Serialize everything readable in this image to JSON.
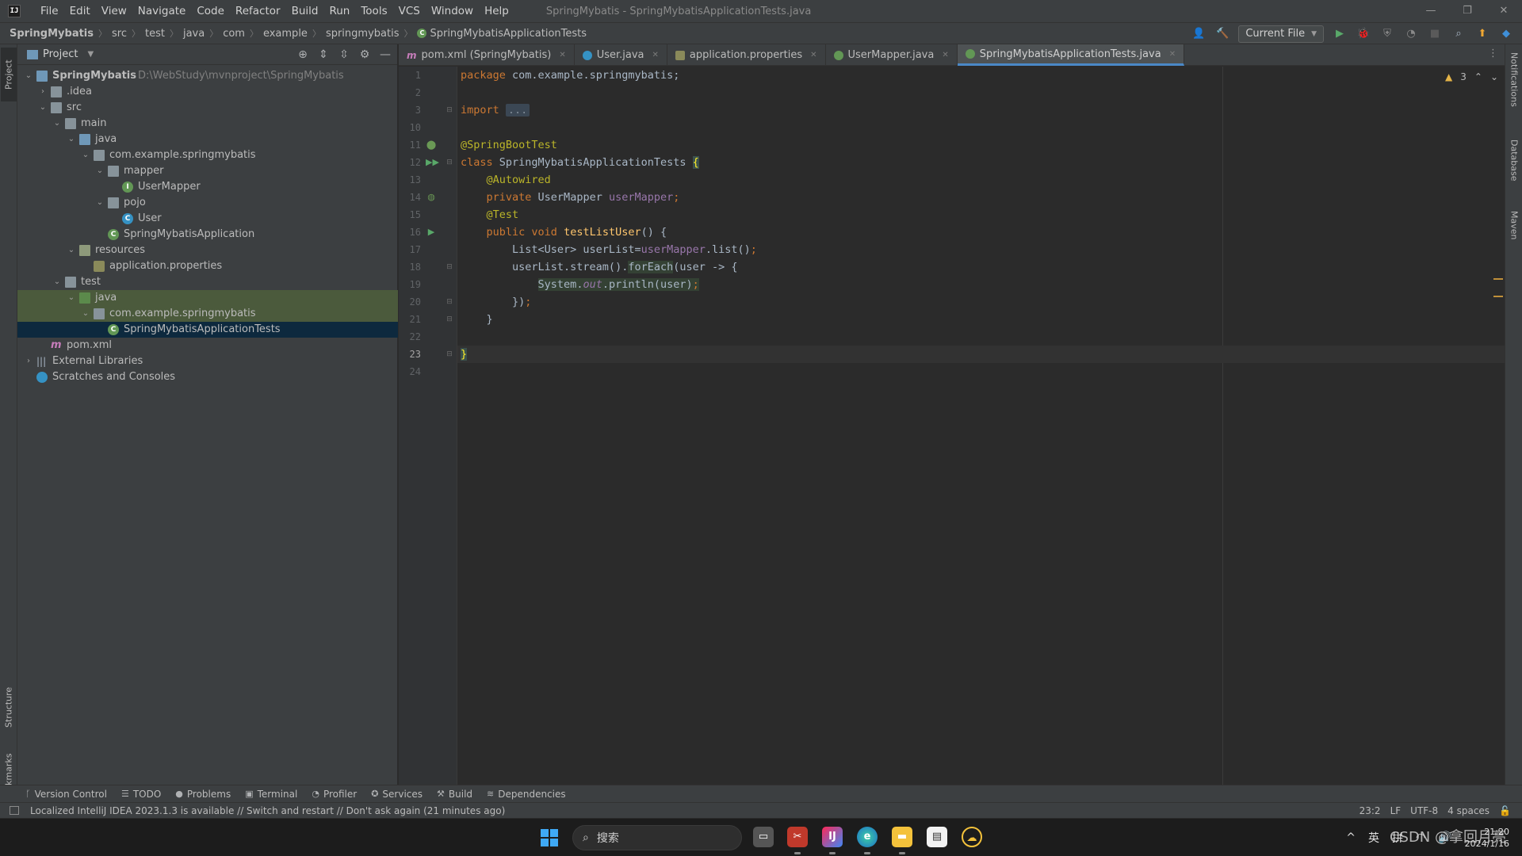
{
  "titlebar": {
    "logo": "IJ",
    "menu": [
      "File",
      "Edit",
      "View",
      "Navigate",
      "Code",
      "Refactor",
      "Build",
      "Run",
      "Tools",
      "VCS",
      "Window",
      "Help"
    ],
    "window_title": "SpringMybatis - SpringMybatisApplicationTests.java",
    "controls": {
      "minimize": "—",
      "restore": "❐",
      "close": "✕"
    }
  },
  "navbar": {
    "breadcrumb": [
      "SpringMybatis",
      "src",
      "test",
      "java",
      "com",
      "example",
      "springmybatis",
      "SpringMybatisApplicationTests"
    ],
    "run_config": "Current File"
  },
  "left_strip": {
    "project": "Project",
    "structure": "Structure",
    "bookmarks": "Bookmarks"
  },
  "right_strip": {
    "notifications": "Notifications",
    "database": "Database",
    "maven": "Maven"
  },
  "project_panel": {
    "title": "Project",
    "tree": [
      {
        "label": "SpringMybatis",
        "path": "D:\\WebStudy\\mvnproject\\SpringMybatis",
        "depth": 0,
        "arrow": "down",
        "icon": "folder-module",
        "bold": true
      },
      {
        "label": ".idea",
        "depth": 1,
        "arrow": "right",
        "icon": "folder"
      },
      {
        "label": "src",
        "depth": 1,
        "arrow": "down",
        "icon": "folder"
      },
      {
        "label": "main",
        "depth": 2,
        "arrow": "down",
        "icon": "folder"
      },
      {
        "label": "java",
        "depth": 3,
        "arrow": "down",
        "icon": "folder-source"
      },
      {
        "label": "com.example.springmybatis",
        "depth": 4,
        "arrow": "down",
        "icon": "folder-package"
      },
      {
        "label": "mapper",
        "depth": 5,
        "arrow": "down",
        "icon": "folder-package"
      },
      {
        "label": "UserMapper",
        "depth": 6,
        "arrow": "",
        "icon": "interface"
      },
      {
        "label": "pojo",
        "depth": 5,
        "arrow": "down",
        "icon": "folder-package"
      },
      {
        "label": "User",
        "depth": 6,
        "arrow": "",
        "icon": "class"
      },
      {
        "label": "SpringMybatisApplication",
        "depth": 5,
        "arrow": "",
        "icon": "spring-class"
      },
      {
        "label": "resources",
        "depth": 3,
        "arrow": "down",
        "icon": "folder-resources"
      },
      {
        "label": "application.properties",
        "depth": 4,
        "arrow": "",
        "icon": "properties"
      },
      {
        "label": "test",
        "depth": 2,
        "arrow": "down",
        "icon": "folder"
      },
      {
        "label": "java",
        "depth": 3,
        "arrow": "down",
        "icon": "folder-test",
        "state": "sel-light"
      },
      {
        "label": "com.example.springmybatis",
        "depth": 4,
        "arrow": "down",
        "icon": "folder-package",
        "state": "sel-light"
      },
      {
        "label": "SpringMybatisApplicationTests",
        "depth": 5,
        "arrow": "",
        "icon": "spring-class",
        "state": "sel"
      },
      {
        "label": "pom.xml",
        "depth": 1,
        "arrow": "",
        "icon": "maven"
      },
      {
        "label": "External Libraries",
        "depth": 0,
        "arrow": "right",
        "icon": "library"
      },
      {
        "label": "Scratches and Consoles",
        "depth": 0,
        "arrow": "",
        "icon": "scratch"
      }
    ]
  },
  "editor": {
    "tabs": [
      {
        "label": "pom.xml (SpringMybatis)",
        "icon": "mvn"
      },
      {
        "label": "User.java",
        "icon": "class"
      },
      {
        "label": "application.properties",
        "icon": "props"
      },
      {
        "label": "UserMapper.java",
        "icon": "interface"
      },
      {
        "label": "SpringMybatisApplicationTests.java",
        "icon": "spring",
        "active": true
      }
    ],
    "inspection": {
      "warnings": "3"
    },
    "line_numbers": [
      "1",
      "2",
      "3",
      "10",
      "11",
      "12",
      "13",
      "14",
      "15",
      "16",
      "17",
      "18",
      "19",
      "20",
      "21",
      "22",
      "23",
      "24"
    ],
    "current_line": "23"
  },
  "tool_windows": [
    "Version Control",
    "TODO",
    "Problems",
    "Terminal",
    "Profiler",
    "Services",
    "Build",
    "Dependencies"
  ],
  "statusbar": {
    "message": "Localized IntelliJ IDEA 2023.1.3 is available // Switch and restart // Don't ask again (21 minutes ago)",
    "position": "23:2",
    "line_sep": "LF",
    "encoding": "UTF-8",
    "indent": "4 spaces"
  },
  "taskbar": {
    "search_placeholder": "搜索",
    "tray_lang1": "英",
    "tray_lang2": "拼",
    "time": "21:20",
    "date": "2024/1/16"
  },
  "watermark": "CSDN @拿回月亮"
}
